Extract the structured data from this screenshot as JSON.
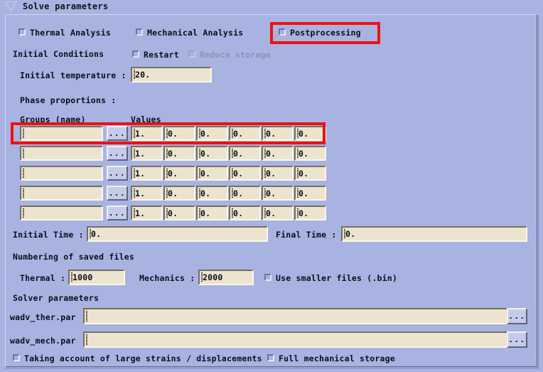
{
  "window": {
    "title": "Solve parameters",
    "toggle_icon": "triangle-down-icon"
  },
  "analysis_options": {
    "thermal": {
      "label": "Thermal Analysis",
      "checked": false
    },
    "mechanical": {
      "label": "Mechanical Analysis",
      "checked": false
    },
    "postprocessing": {
      "label": "Postprocessing",
      "checked": false,
      "highlighted": true
    }
  },
  "initial_conditions": {
    "section_label": "Initial Conditions",
    "restart": {
      "label": "Restart",
      "checked": false,
      "enabled": true
    },
    "reduce_storage": {
      "label": "Reduce storage",
      "checked": false,
      "enabled": false
    },
    "temperature": {
      "label": "Initial temperature :",
      "value": "20."
    }
  },
  "phase_proportions": {
    "section_label": "Phase proportions :",
    "col_groups": "Groups (name)",
    "col_values": "Values",
    "browse_label": "...",
    "rows": [
      {
        "group": "",
        "values": [
          "1.",
          "0.",
          "0.",
          "0.",
          "0.",
          "0."
        ],
        "highlighted": true
      },
      {
        "group": "",
        "values": [
          "1.",
          "0.",
          "0.",
          "0.",
          "0.",
          "0."
        ],
        "highlighted": false
      },
      {
        "group": "",
        "values": [
          "1.",
          "0.",
          "0.",
          "0.",
          "0.",
          "0."
        ],
        "highlighted": false
      },
      {
        "group": "",
        "values": [
          "1.",
          "0.",
          "0.",
          "0.",
          "0.",
          "0."
        ],
        "highlighted": false
      },
      {
        "group": "",
        "values": [
          "1.",
          "0.",
          "0.",
          "0.",
          "0.",
          "0."
        ],
        "highlighted": false
      }
    ]
  },
  "time": {
    "initial_label": "Initial Time :",
    "initial_value": "0.",
    "final_label": "Final Time :",
    "final_value": "0."
  },
  "numbering": {
    "section_label": "Numbering of saved files",
    "thermal_label": "Thermal :",
    "thermal_value": "1000",
    "mechanics_label": "Mechanics :",
    "mechanics_value": "2000",
    "smaller_files": {
      "label": "Use smaller files (.bin)",
      "checked": false
    }
  },
  "solver": {
    "section_label": "Solver parameters",
    "browse_label": "...",
    "thermal_file": {
      "label": "wadv_ther.par",
      "value": ""
    },
    "mech_file": {
      "label": "wadv_mech.par",
      "value": ""
    }
  },
  "footer": {
    "large_strains": {
      "label": "Taking account of large strains / displacements",
      "checked": false
    },
    "full_storage": {
      "label": "Full mechanical storage",
      "checked": false
    }
  },
  "colors": {
    "background": "#a9b3e2",
    "field_background": "#ece4ce",
    "highlight": "#ee1111",
    "text": "#0c0f18",
    "disabled_text": "#8a92b8"
  }
}
